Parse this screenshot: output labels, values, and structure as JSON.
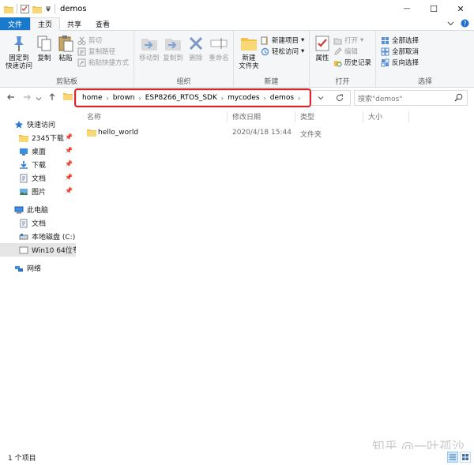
{
  "window": {
    "title": "demos",
    "minimize": "—",
    "maximize": "☐",
    "close": "✕"
  },
  "tabs": [
    {
      "label": "文件"
    },
    {
      "label": "主页"
    },
    {
      "label": "共享"
    },
    {
      "label": "查看"
    }
  ],
  "ribbon": {
    "clipboard": {
      "label": "剪贴板",
      "pin": "固定到\n快速访问",
      "copy": "复制",
      "paste": "粘贴",
      "cut": "剪切",
      "copy_path": "复制路径",
      "paste_shortcut": "粘贴快捷方式"
    },
    "organize": {
      "label": "组织",
      "move_to": "移动到",
      "copy_to": "复制到",
      "delete": "删除",
      "rename": "重命名"
    },
    "new": {
      "label": "新建",
      "new_folder": "新建\n文件夹",
      "new_item": "新建项目",
      "easy_access": "轻松访问"
    },
    "open": {
      "label": "打开",
      "properties": "属性",
      "open": "打开",
      "edit": "编辑",
      "history": "历史记录"
    },
    "select": {
      "label": "选择",
      "select_all": "全部选择",
      "select_none": "全部取消",
      "invert": "反向选择"
    }
  },
  "address": {
    "crumbs": [
      "home",
      "brown",
      "ESP8266_RTOS_SDK",
      "mycodes",
      "demos"
    ],
    "search_placeholder": "搜索\"demos\""
  },
  "nav": {
    "quick_access": "快速访问",
    "items": [
      {
        "label": "2345下载"
      },
      {
        "label": "桌面"
      },
      {
        "label": "下载"
      },
      {
        "label": "文档"
      },
      {
        "label": "图片"
      }
    ],
    "this_pc": "此电脑",
    "pc_items": [
      {
        "label": "文档"
      },
      {
        "label": "本地磁盘 (C:)"
      },
      {
        "label": "Win10 64位专"
      }
    ],
    "network": "网络"
  },
  "columns": {
    "name": "名称",
    "modified": "修改日期",
    "type": "类型",
    "size": "大小"
  },
  "files": [
    {
      "name": "hello_world",
      "modified": "2020/4/18 15:44",
      "type": "文件夹",
      "size": ""
    }
  ],
  "status": {
    "count": "1 个项目"
  },
  "watermark": "知乎 @一叶孤沙",
  "colors": {
    "accent": "#1979ca",
    "highlight_box": "#e0242c",
    "folder": "#f3c04e"
  },
  "icons": {
    "folder": "folder-icon",
    "pin": "pin-icon"
  }
}
